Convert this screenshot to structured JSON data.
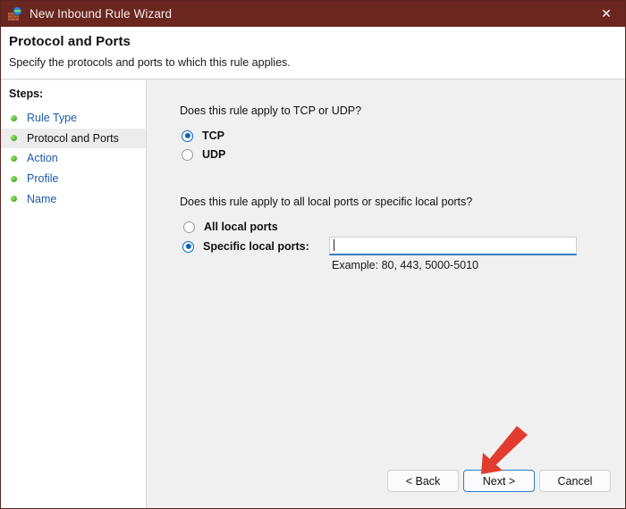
{
  "window": {
    "title": "New Inbound Rule Wizard",
    "icon": "firewall-globe-icon",
    "close_label": "✕",
    "titlebar_color": "#6b2620"
  },
  "header": {
    "title": "Protocol and Ports",
    "subtitle": "Specify the protocols and ports to which this rule applies."
  },
  "sidebar": {
    "label": "Steps:",
    "items": [
      {
        "label": "Rule Type",
        "current": false
      },
      {
        "label": "Protocol and Ports",
        "current": true
      },
      {
        "label": "Action",
        "current": false
      },
      {
        "label": "Profile",
        "current": false
      },
      {
        "label": "Name",
        "current": false
      }
    ]
  },
  "main": {
    "question_protocol": "Does this rule apply to TCP or UDP?",
    "protocol_options": [
      {
        "label": "TCP",
        "selected": true
      },
      {
        "label": "UDP",
        "selected": false
      }
    ],
    "question_ports": "Does this rule apply to all local ports or specific local ports?",
    "port_options": [
      {
        "label": "All local ports",
        "selected": false
      },
      {
        "label": "Specific local ports:",
        "selected": true
      }
    ],
    "ports_input_value": "",
    "ports_input_placeholder": "",
    "ports_example": "Example: 80, 443, 5000-5010"
  },
  "footer": {
    "back_label": "< Back",
    "next_label": "Next >",
    "cancel_label": "Cancel"
  },
  "annotation": {
    "arrow_color": "#e23b30",
    "points_to": "Next >"
  }
}
